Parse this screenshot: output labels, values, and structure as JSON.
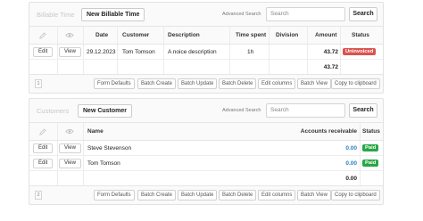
{
  "billable": {
    "title": "Billable Time",
    "new_button": "New Billable Time",
    "advanced_search": "Advanced Search",
    "search_placeholder": "Search",
    "search_button": "Search",
    "columns": [
      "Date",
      "Customer",
      "Description",
      "Time spent",
      "Division",
      "Amount",
      "Status"
    ],
    "rows": [
      {
        "edit": "Edit",
        "view": "View",
        "date": "29.12.2023",
        "customer": "Tom Tomson",
        "description": "A noice description",
        "time_spent": "1h",
        "division": "",
        "amount": "43.72",
        "status": "Uninvoiced"
      }
    ],
    "total": "43.72",
    "count": "1",
    "footer_buttons": [
      "Form Defaults",
      "Batch Create",
      "Batch Update",
      "Batch Delete",
      "Edit columns",
      "Batch View",
      "Copy to clipboard"
    ]
  },
  "customers": {
    "title": "Customers",
    "new_button": "New Customer",
    "advanced_search": "Advanced Search",
    "search_placeholder": "Search",
    "search_button": "Search",
    "columns": [
      "Name",
      "Accounts receivable",
      "Status"
    ],
    "rows": [
      {
        "edit": "Edit",
        "view": "View",
        "name": "Steve Stevenson",
        "receivable": "0.00",
        "status": "Paid"
      },
      {
        "edit": "Edit",
        "view": "View",
        "name": "Tom Tomson",
        "receivable": "0.00",
        "status": "Paid"
      }
    ],
    "total": "0.00",
    "count": "2",
    "footer_buttons": [
      "Form Defaults",
      "Batch Create",
      "Batch Update",
      "Batch Delete",
      "Edit columns",
      "Batch View",
      "Copy to clipboard"
    ]
  },
  "icons": {
    "edit_column": "pencil-icon",
    "view_column": "eye-icon"
  },
  "colors": {
    "uninvoiced": "#d9534f",
    "paid": "#28a745",
    "amount_blue": "#2f7ec3"
  }
}
